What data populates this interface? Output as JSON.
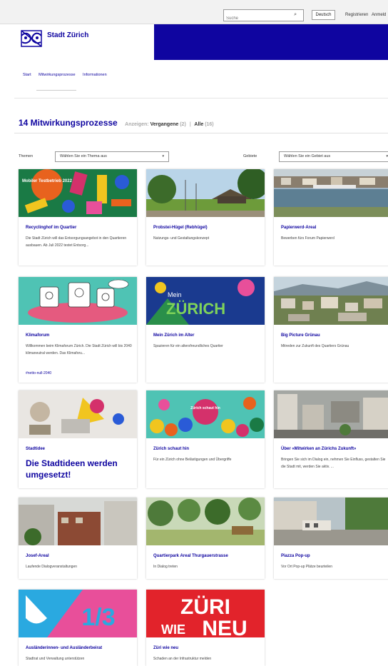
{
  "topbar": {
    "search_placeholder": "Suche",
    "language_label": "Deutsch",
    "register_label": "Registrieren",
    "login_label": "Anmeld"
  },
  "header": {
    "brand": "Stadt Zürich",
    "accent_color": "#0f05a0"
  },
  "nav": {
    "items": [
      "Start",
      "Mitwirkungsprozesse",
      "Informationen"
    ]
  },
  "heading": {
    "title": "14 Mitwirkungsprozesse",
    "show_label": "Anzeigen:",
    "past_label": "Vergangene",
    "past_count": "(2)",
    "separator": "|",
    "all_label": "Alle",
    "all_count": "(16)"
  },
  "filters": {
    "themes_label": "Themen",
    "themes_value": "Wählen Sie ein Thema aus",
    "areas_label": "Gebiete",
    "areas_value": "Wählen Sie ein Gebiet aus"
  },
  "cards": [
    {
      "title": "Recyclinghof im Quartier",
      "description": "Die Stadt Zürich will das Entsorgungsangebot in den Quartieren ausbauen. Ab Juli 2022 testet Entsorg...",
      "image": "poster-collage"
    },
    {
      "title": "Probstei-Hügel (Rebhügel)",
      "description": "Nutzungs- und Gestaltungskonzept",
      "image": "park-photo"
    },
    {
      "title": "Papierwerd-Areal",
      "description": "Bewerben fürs Forum Papierwerd",
      "image": "river-photo"
    },
    {
      "title": "Klimaforum",
      "description": "Willkommen beim Klimaforum Zürich. Die Stadt Zürich will bis 2040 klimaneutral werden. Das Klimaforu...",
      "tag": "#netto-null-2040",
      "image": "illustration"
    },
    {
      "title": "Mein Zürich im Alter",
      "description": "Spazieren für ein altersfreundliches Quartier",
      "image": "mein-zuerich-poster"
    },
    {
      "title": "Big Picture Grünau",
      "description": "Mitreden zur Zukunft des Quartiers Grünau",
      "image": "aerial-photo"
    },
    {
      "title": "Stadtidee",
      "big_text": "Die Stadtideen werden umgesetzt!",
      "image": "idea-photo"
    },
    {
      "title": "Zürich schaut hin",
      "description": "Für ein Zürich ohne Belästigungen und Übergriffe",
      "image": "crowd-illustration"
    },
    {
      "title": "Über «Mitwirken an Zürichs Zukunft»",
      "description": "Bringen Sie sich im Dialog ein, nehmen Sie Einfluss, gestalten Sie die Stadt mit, werden Sie aktiv. ...",
      "image": "city-aerial"
    },
    {
      "title": "Josef-Areal",
      "description": "Laufende Dialogveranstaltungen",
      "image": "building-photo"
    },
    {
      "title": "Quartierpark Areal Thurgauerstrasse",
      "description": "In Dialog treten",
      "image": "trees-photo"
    },
    {
      "title": "Piazza Pop-up",
      "description": "Vor Ort Pop-up Plätze beurteilen",
      "image": "street-photo"
    },
    {
      "title": "Ausländerinnen- und Ausländerbeirat",
      "description": "Stadtrat und Verwaltung unterstützen",
      "image": "one-third-poster",
      "image_text": "1/3"
    },
    {
      "title": "Züri wie neu",
      "description": "Schaden an der Infrastruktur melden",
      "image": "zueri-wie-neu-logo",
      "image_text_1": "ZÜRI",
      "image_text_2": "WIE",
      "image_text_3": "NEU"
    }
  ],
  "poster_text": {
    "recycling": "Mobiler Testbetrieb 2022",
    "mein": "Mein",
    "zuerich": "ZÜRICH",
    "schaut": "Zürich schaut hin"
  }
}
